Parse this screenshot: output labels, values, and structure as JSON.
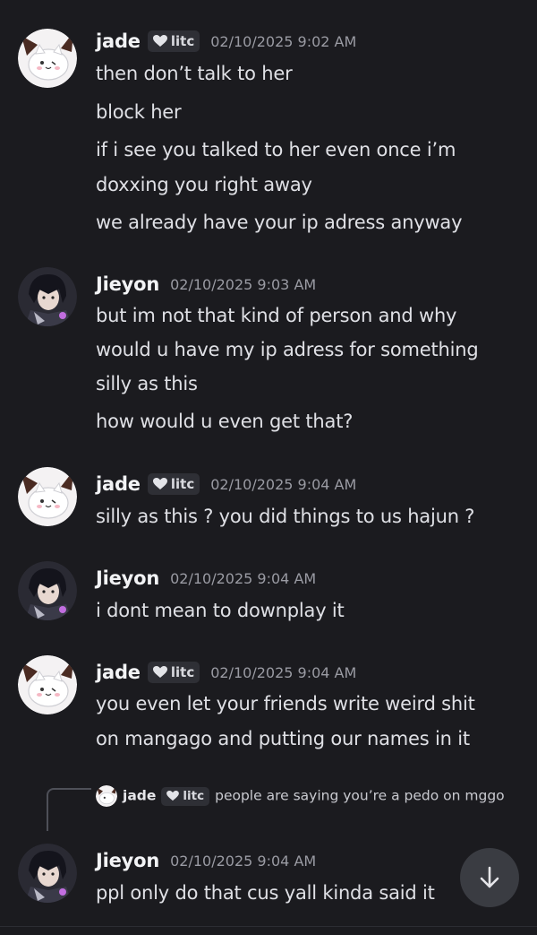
{
  "messages": [
    {
      "author": "jade",
      "tag": "litc",
      "time": "02/10/2025 9:02 AM",
      "lines": [
        "then don’t talk to her",
        "block her",
        "if i see you talked to her even once i’m",
        "doxxing you right away",
        "we already have your ip adress anyway"
      ]
    },
    {
      "author": "Jieyon",
      "time": "02/10/2025 9:03 AM",
      "lines": [
        "but im not that kind of person and why",
        "would u have my ip adress for something",
        "silly as this",
        "how would u even get that?"
      ]
    },
    {
      "author": "jade",
      "tag": "litc",
      "time": "02/10/2025 9:04 AM",
      "lines": [
        "silly as this ? you did things to us hajun ?"
      ]
    },
    {
      "author": "Jieyon",
      "time": "02/10/2025 9:04 AM",
      "lines": [
        "i dont mean to downplay it"
      ]
    },
    {
      "author": "jade",
      "tag": "litc",
      "time": "02/10/2025 9:04 AM",
      "lines": [
        "you even let your friends write weird shit",
        "on mangago and putting our names in it"
      ]
    },
    {
      "reply": {
        "author": "jade",
        "tag": "litc",
        "text": "people are saying you’re a pedo on mggo"
      },
      "author": "Jieyon",
      "time": "02/10/2025 9:04 AM",
      "lines": [
        "ppl only do that cus yall kinda said it"
      ]
    }
  ],
  "icons": {
    "tag_icon": "heart-icon",
    "scroll_button": "arrow-down-icon"
  },
  "colors": {
    "background": "#1b1b1f",
    "timestamp": "#9a9ba3"
  }
}
